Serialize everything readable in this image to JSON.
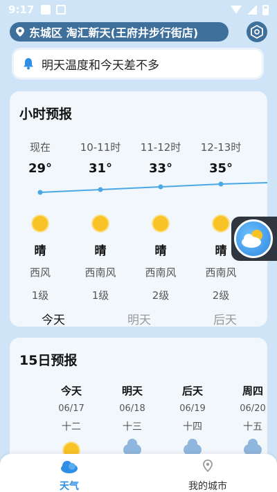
{
  "status_bar": {
    "time": "9:17"
  },
  "header": {
    "location": "东城区 淘汇新天(王府井步行街店)"
  },
  "notice": {
    "text": "明天温度和今天差不多"
  },
  "hourly": {
    "title": "小时预报",
    "items": [
      {
        "label": "现在",
        "temp": "29°",
        "condition": "晴",
        "wind": "西风",
        "level": "1级"
      },
      {
        "label": "10-11时",
        "temp": "31°",
        "condition": "晴",
        "wind": "西南风",
        "level": "1级"
      },
      {
        "label": "11-12时",
        "temp": "33°",
        "condition": "晴",
        "wind": "西南风",
        "level": "2级"
      },
      {
        "label": "12-13时",
        "temp": "35°",
        "condition": "晴",
        "wind": "西南风",
        "level": "2级"
      }
    ],
    "tabs": [
      "今天",
      "明天",
      "后天"
    ]
  },
  "daily": {
    "title": "15日预报",
    "items": [
      {
        "day": "今天",
        "date": "06/17",
        "lunar": "十二",
        "icon": "sun-icon"
      },
      {
        "day": "明天",
        "date": "06/18",
        "lunar": "十三",
        "icon": "cloud-icon"
      },
      {
        "day": "后天",
        "date": "06/19",
        "lunar": "十四",
        "icon": "cloud-icon"
      },
      {
        "day": "周四",
        "date": "06/20",
        "lunar": "十五",
        "icon": "cloud-icon"
      }
    ]
  },
  "nav": {
    "weather": "天气",
    "city": "我的城市"
  }
}
